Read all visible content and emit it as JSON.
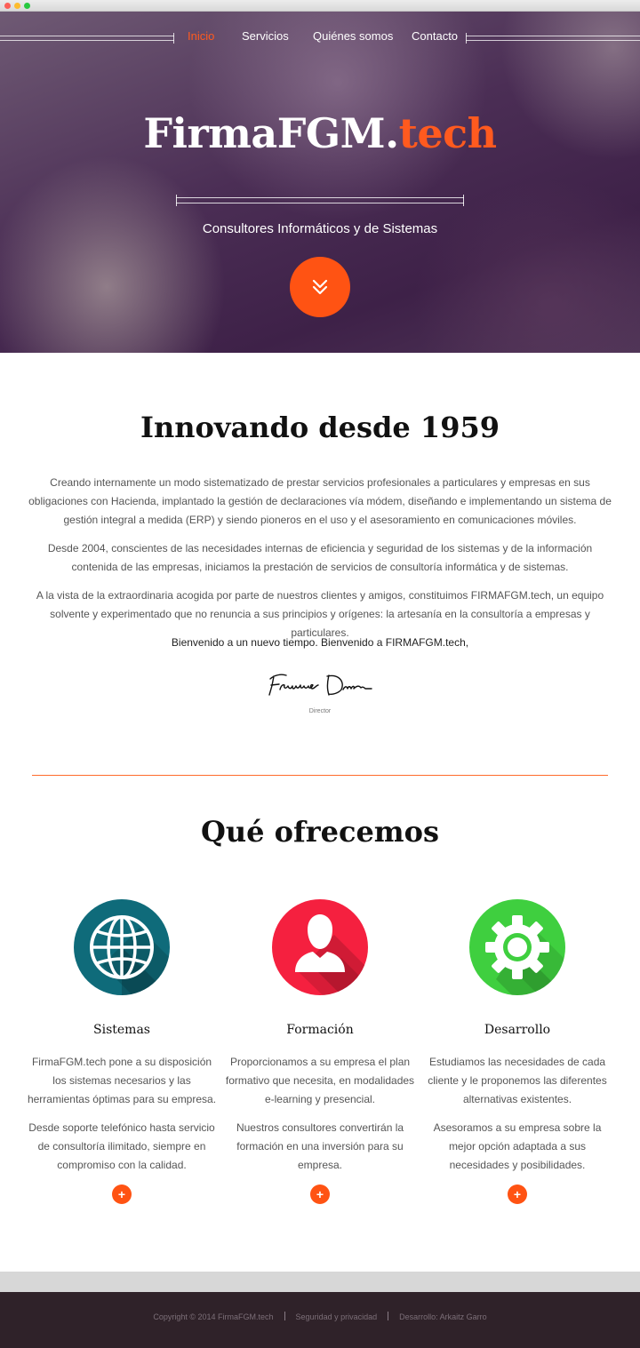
{
  "nav": {
    "items": [
      {
        "label": "Inicio",
        "active": true
      },
      {
        "label": "Servicios",
        "active": false
      },
      {
        "label": "Quiénes somos",
        "active": false
      },
      {
        "label": "Contacto",
        "active": false
      }
    ]
  },
  "hero": {
    "brand_main": "FirmaFGM.",
    "brand_accent": "tech",
    "tagline": "Consultores Informáticos y de Sistemas",
    "scroll_icon": "double-chevron-down-icon"
  },
  "about": {
    "title": "Innovando desde 1959",
    "paragraphs": [
      "Creando internamente un modo sistematizado de prestar servicios profesionales a particulares y empresas en sus obligaciones con Hacienda, implantado la gestión de declaraciones vía módem, diseñando e implementando un sistema de gestión integral a medida (ERP) y siendo pioneros en el uso y el asesoramiento en comunicaciones móviles.",
      "Desde 2004, conscientes de las necesidades internas de eficiencia y seguridad de los sistemas y de la información contenida de las empresas, iniciamos la prestación de servicios de consultoría informática y de sistemas.",
      "A la vista de la extraordinaria acogida por parte de nuestros clientes y amigos, constituimos FIRMAFGM.tech, un equipo solvente y experimentado que no renuncia a sus principios y orígenes: la artesanía en la consultoría a empresas y particulares."
    ],
    "welcome": "Bienvenido a un nuevo tiempo. Bienvenido a FIRMAFGM.tech,",
    "signature_text": "Francisco Doral",
    "signature_role": "Director"
  },
  "services": {
    "title": "Qué ofrecemos",
    "items": [
      {
        "icon": "globe-icon",
        "color": "#0f6b7a",
        "title": "Sistemas",
        "text1": "FirmaFGM.tech pone a su disposición los sistemas necesarios y las herramientas óptimas para su empresa.",
        "text2": "Desde soporte telefónico hasta servicio de consultoría ilimitado, siempre en compromiso con la calidad.",
        "more": "+"
      },
      {
        "icon": "user-icon",
        "color": "#f5203f",
        "title": "Formación",
        "text1": "Proporcionamos a su empresa el plan formativo que necesita, en modalidades e-learning y presencial.",
        "text2": "Nuestros consultores convertirán la formación en una inversión para su empresa.",
        "more": "+"
      },
      {
        "icon": "gear-icon",
        "color": "#3fcf3f",
        "title": "Desarrollo",
        "text1": "Estudiamos las necesidades de cada cliente y le proponemos las diferentes alternativas existentes.",
        "text2": "Asesoramos a su empresa sobre la mejor opción adaptada a sus necesidades y posibilidades.",
        "more": "+"
      }
    ]
  },
  "footer": {
    "copyright": "Copyright © 2014 FirmaFGM.tech",
    "privacy": "Seguridad y privacidad",
    "credits": "Desarrollo: Arkaitz Garro"
  },
  "colors": {
    "accent": "#ff5313",
    "hero_bg": "#4b2e55",
    "footer_bg": "#2f2229"
  }
}
